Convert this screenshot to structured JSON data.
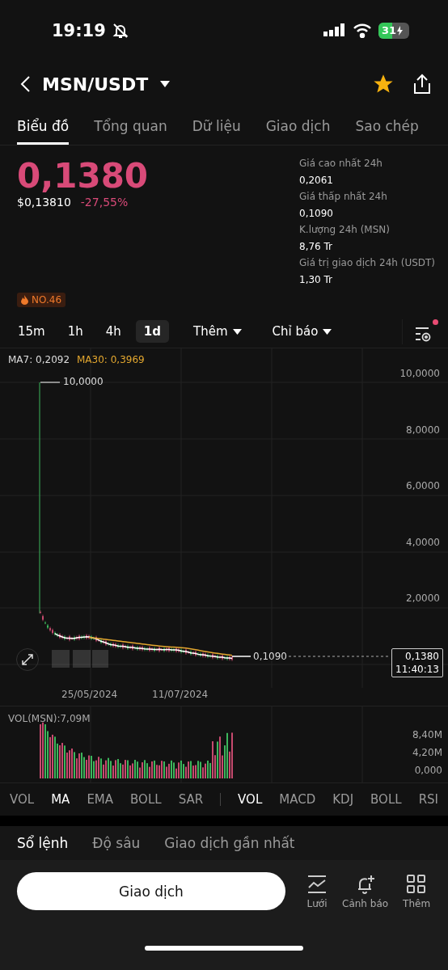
{
  "status_bar": {
    "time": "19:19",
    "battery": "31"
  },
  "header": {
    "pair": "MSN/USDT",
    "favorite": true
  },
  "tabs": [
    {
      "label": "Biểu đồ",
      "selected": true
    },
    {
      "label": "Tổng quan",
      "selected": false
    },
    {
      "label": "Dữ liệu",
      "selected": false
    },
    {
      "label": "Giao dịch",
      "selected": false
    },
    {
      "label": "Sao chép",
      "selected": false
    }
  ],
  "price": {
    "last": "0,1380",
    "usd": "$0,13810",
    "change": "-27,55%",
    "rank": "NO.46"
  },
  "stats": [
    {
      "label": "Giá cao nhất 24h",
      "value": "0,2061"
    },
    {
      "label": "Giá thấp nhất 24h",
      "value": "0,1090"
    },
    {
      "label": "K.lượng 24h (MSN)",
      "value": "8,76 Tr"
    },
    {
      "label": "Giá trị giao dịch 24h (USDT)",
      "value": "1,30 Tr"
    }
  ],
  "timeframes": [
    {
      "label": "15m",
      "selected": false
    },
    {
      "label": "1h",
      "selected": false
    },
    {
      "label": "4h",
      "selected": false
    },
    {
      "label": "1d",
      "selected": true
    }
  ],
  "dropdowns": [
    "Thêm",
    "Chỉ báo"
  ],
  "chart_settings": {
    "has_notification": true
  },
  "chart": {
    "ma7": "MA7: 0,2092",
    "ma30": "MA30: 0,3969",
    "price_ticks": [
      "10,0000",
      "8,0000",
      "6,0000",
      "4,0000",
      "2,0000"
    ],
    "high_label": "10,0000",
    "low_label": "0,1090",
    "current_price": "0,1380",
    "countdown": "11:40:13",
    "dates": [
      "25/05/2024",
      "11/07/2024"
    ]
  },
  "volume": {
    "label": "VOL(MSN):7,09M",
    "ticks": [
      "8,40M",
      "4,20M",
      "0,000"
    ]
  },
  "indicators_main": [
    {
      "label": "VOL",
      "selected": false
    },
    {
      "label": "MA",
      "selected": true
    },
    {
      "label": "EMA",
      "selected": false
    },
    {
      "label": "BOLL",
      "selected": false
    },
    {
      "label": "SAR",
      "selected": false
    }
  ],
  "indicators_sub": [
    {
      "label": "VOL",
      "selected": true
    },
    {
      "label": "MACD",
      "selected": false
    },
    {
      "label": "KDJ",
      "selected": false
    },
    {
      "label": "BOLL",
      "selected": false
    },
    {
      "label": "RSI",
      "selected": false
    }
  ],
  "bottom_tabs": [
    {
      "label": "Sổ lệnh",
      "selected": true
    },
    {
      "label": "Độ sâu",
      "selected": false
    },
    {
      "label": "Giao dịch gần nhất",
      "selected": false
    }
  ],
  "trade_button": "Giao dịch",
  "actions": [
    {
      "kind": "grid",
      "label": "Lưới"
    },
    {
      "kind": "alert",
      "label": "Cảnh báo"
    },
    {
      "kind": "more",
      "label": "Thêm"
    }
  ]
}
